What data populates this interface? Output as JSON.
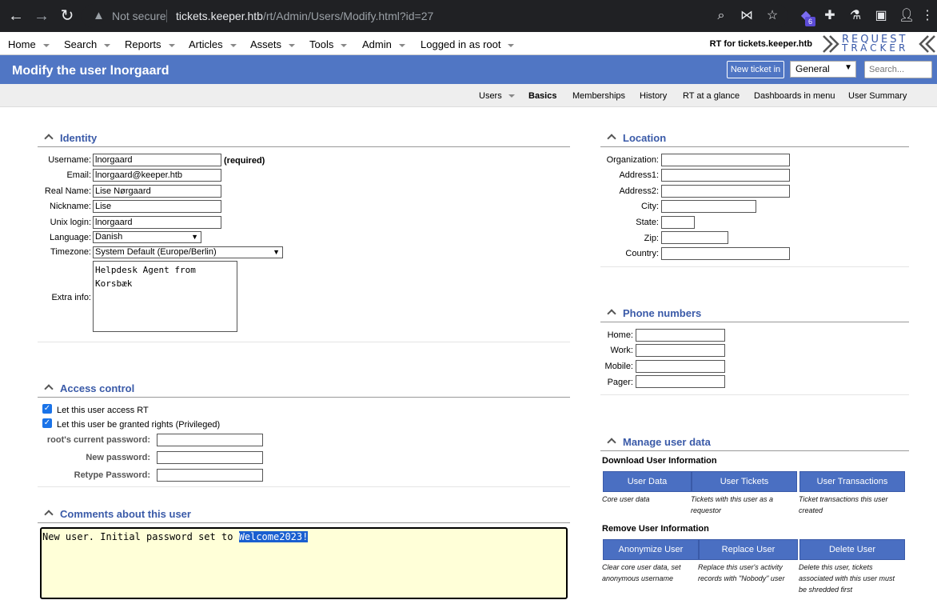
{
  "browser": {
    "not_secure": "Not secure",
    "url_host": "tickets.keeper.htb",
    "url_path": "/rt/Admin/Users/Modify.html?id=27",
    "extension_badge": "6"
  },
  "topmenu": {
    "items": [
      "Home",
      "Search",
      "Reports",
      "Articles",
      "Assets",
      "Tools",
      "Admin",
      "Logged in as root"
    ],
    "rt_for": "RT for tickets.keeper.htb",
    "logo_line1": "REQUEST",
    "logo_line2": "TRACKER"
  },
  "title": "Modify the user lnorgaard",
  "new_ticket_button": "New ticket in",
  "queue_selected": "General",
  "search_placeholder": "Search...",
  "submenu": {
    "items": [
      "Users",
      "Basics",
      "Memberships",
      "History",
      "RT at a glance",
      "Dashboards in menu",
      "User Summary"
    ],
    "active": "Basics"
  },
  "identity": {
    "title": "Identity",
    "username_label": "Username:",
    "username": "lnorgaard",
    "required": "(required)",
    "email_label": "Email:",
    "email": "lnorgaard@keeper.htb",
    "realname_label": "Real Name:",
    "realname": "Lise Nørgaard",
    "nickname_label": "Nickname:",
    "nickname": "Lise",
    "unix_label": "Unix login:",
    "unix": "lnorgaard",
    "language_label": "Language:",
    "language": "Danish",
    "timezone_label": "Timezone:",
    "timezone": "System Default (Europe/Berlin)",
    "extra_label": "Extra info:",
    "extra": "Helpdesk Agent from\nKorsbæk"
  },
  "access": {
    "title": "Access control",
    "access_rt": "Let this user access RT",
    "privileged": "Let this user be granted rights (Privileged)",
    "current_pw_label": "root's current password:",
    "new_pw_label": "New password:",
    "retype_pw_label": "Retype Password:"
  },
  "comments": {
    "title": "Comments about this user",
    "text_prefix": "New user. Initial password set to ",
    "text_highlight": "Welcome2023!"
  },
  "location": {
    "title": "Location",
    "organization_label": "Organization:",
    "address1_label": "Address1:",
    "address2_label": "Address2:",
    "city_label": "City:",
    "state_label": "State:",
    "zip_label": "Zip:",
    "country_label": "Country:"
  },
  "phones": {
    "title": "Phone numbers",
    "home_label": "Home:",
    "work_label": "Work:",
    "mobile_label": "Mobile:",
    "pager_label": "Pager:"
  },
  "manage": {
    "title": "Manage user data",
    "download_head": "Download User Information",
    "user_data": "User Data",
    "user_data_desc": "Core user data",
    "user_tickets": "User Tickets",
    "user_tickets_desc": "Tickets with this user as a requestor",
    "user_transactions": "User Transactions",
    "user_transactions_desc": "Ticket transactions this user created",
    "remove_head": "Remove User Information",
    "anonymize": "Anonymize User",
    "anonymize_desc": "Clear core user data, set anonymous username",
    "replace": "Replace User",
    "replace_desc": "Replace this user's activity records with \"Nobody\" user",
    "delete": "Delete User",
    "delete_desc": "Delete this user, tickets associated with this user must be shredded first"
  }
}
